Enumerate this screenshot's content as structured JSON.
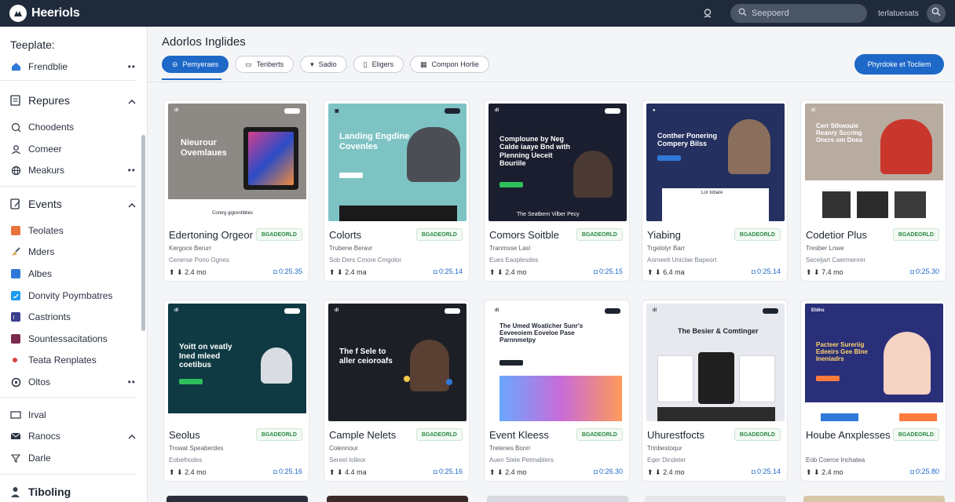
{
  "app": {
    "title": "Heeriols"
  },
  "topbar": {
    "search_placeholder": "Seepoerd",
    "user_text": "terlatuesats"
  },
  "sidebar": {
    "label": "Teeplate:",
    "top_item": "Frendblie",
    "sections": [
      {
        "title": "Repures",
        "items": [
          {
            "label": "Choodents",
            "icon": "bubble-icon"
          },
          {
            "label": "Comeer",
            "icon": "user-icon"
          },
          {
            "label": "Meakurs",
            "icon": "globe-icon",
            "dots": true
          }
        ]
      },
      {
        "title": "Events",
        "items": [
          {
            "label": "Teolates",
            "icon": "orange-square-icon",
            "color": "#e8743b"
          },
          {
            "label": "Mders",
            "icon": "brush-icon",
            "color": "#d9a441"
          },
          {
            "label": "Albes",
            "icon": "blue-square-icon",
            "color": "#2f7ad9"
          },
          {
            "label": "Donvity Poymbatres",
            "icon": "twitter-icon",
            "color": "#1d9bf0"
          },
          {
            "label": "Castrionts",
            "icon": "purple-square-icon",
            "color": "#3b3f8c"
          },
          {
            "label": "Sountessacitations",
            "icon": "maroon-square-icon",
            "color": "#7a2a4a"
          },
          {
            "label": "Teata Renplates",
            "icon": "red-dot-icon",
            "color": "#d94141"
          },
          {
            "label": "Oltos",
            "icon": "circle-icon",
            "dots": true
          }
        ]
      }
    ],
    "lower_items": [
      {
        "label": "Irval",
        "icon": "rect-icon"
      },
      {
        "label": "Ranocs",
        "icon": "mail-icon",
        "chevron": true
      },
      {
        "label": "Darle",
        "icon": "filter-icon"
      }
    ],
    "bottom_label": "Tiboling"
  },
  "main": {
    "title": "Adorlos Inglides",
    "tabs": [
      {
        "label": "Pemyeraes",
        "icon": "⊖",
        "active": true
      },
      {
        "label": "Tenberts",
        "icon": "▭"
      },
      {
        "label": "Sadio",
        "icon": "▾"
      },
      {
        "label": "Eligers",
        "icon": "▯"
      },
      {
        "label": "Compon Horlie",
        "icon": "▦"
      }
    ],
    "cta_label": "Phyrdoke et Tocliem"
  },
  "cards": [
    {
      "title": "Edertoning Orgeor",
      "badge": "BGADEORLD",
      "meta1": "Kergoce Berurr",
      "meta2": "Cenerse Pono Ognes",
      "stats": "⬆ ⬇ 2.4 mo",
      "price": "0:25.35",
      "thumb": {
        "headline": "Nieurour Ovemlaues",
        "caption": "Corerg gigrentiblies",
        "bg": "#8d8a86",
        "fg": "#ffffff"
      }
    },
    {
      "title": "Colorts",
      "badge": "BGADEORLD",
      "meta1": "Trubene Beravr",
      "meta2": "Sob Ders Cmore Cmgolor",
      "stats": "⬆ ⬇ 2.4 ma",
      "price": "0:25.14",
      "thumb": {
        "headline": "Landing Engdine Covenles",
        "caption": "",
        "bg": "#7ec3c4",
        "fg": "#ffffff"
      }
    },
    {
      "title": "Comors Soitble",
      "badge": "BGADEORLD",
      "meta1": "Tranmsse Lasl",
      "meta2": "Eues Eaoplesdes",
      "stats": "⬆ ⬇ 2.4 mo",
      "price": "0:25.15",
      "thumb": {
        "headline": "Comploune by Neg Calde iaaye Bnd with Plenning Ueceit Bouriile",
        "caption": "The Seatbern Vilber Pecy",
        "bg": "#1a1e2e",
        "fg": "#ffffff"
      }
    },
    {
      "title": "Yiabing",
      "badge": "BGADEORLD",
      "meta1": "Trgelolyr Barr",
      "meta2": "Anmeelt Uniclae Bapeort",
      "stats": "⬆ ⬇ 6.4 ma",
      "price": "0:25.14",
      "thumb": {
        "headline": "Conther Ponering Compery Bilss",
        "caption": "Lor tobare",
        "bg": "#24305f",
        "fg": "#ffffff"
      }
    },
    {
      "title": "Codetior Plus",
      "badge": "BGADEORLD",
      "meta1": "Tresber Lnwe",
      "meta2": "Seceljart Caermenrer",
      "stats": "⬆ ⬇ 7.4 mo",
      "price": "0:25.30",
      "thumb": {
        "headline": "Cerr Sthwouie Reanry Sccring Oncrs om Doea",
        "caption": "",
        "bg": "#b8aba0",
        "fg": "#ffffff"
      }
    },
    {
      "title": "Seolus",
      "badge": "BGADEORLD",
      "meta1": "Trowat Speaberdes",
      "meta2": "Eobelhodes",
      "stats": "⬆ ⬇ 2.4 mo",
      "price": "0:25.16",
      "thumb": {
        "headline": "Yoitt on veatly Ined mleed coetibus",
        "caption": "",
        "bg": "#0f3a44",
        "fg": "#ffffff"
      }
    },
    {
      "title": "Cample Nelets",
      "badge": "BGADEORLD",
      "meta1": "Colennour",
      "meta2": "Sereel lolleor",
      "stats": "⬆ ⬇ 4.4 ma",
      "price": "0:25.16",
      "thumb": {
        "headline": "The f Sele to aller ceioroafs",
        "caption": "",
        "bg": "#1c1f26",
        "fg": "#ffffff"
      }
    },
    {
      "title": "Event Kleess",
      "badge": "BGADEORLD",
      "meta1": "Trelenes Bonrr",
      "meta2": "Auen Stele Petmablers",
      "stats": "⬆ ⬇ 2.4 mo",
      "price": "0:26.30",
      "thumb": {
        "headline": "The Umed Woaticher Sunr's Eeveeoiem Eoveloe Pase Parnnmetpy",
        "caption": "",
        "bg": "#ffffff",
        "fg": "#1d2430"
      }
    },
    {
      "title": "Uhurestfocts",
      "badge": "BGADEORLD",
      "meta1": "Trinbestoqur",
      "meta2": "Eqer Dindeter",
      "stats": "⬆ ⬇ 2.4 mo",
      "price": "0:25.14",
      "thumb": {
        "headline": "The Besier & Comtinger",
        "caption": "",
        "bg": "#e7e9ee",
        "fg": "#1d2430"
      }
    },
    {
      "title": "Hoube Anxplesses",
      "badge": "BGADEORLD",
      "meta1": "Eob Coerce Inchatea",
      "meta2": "",
      "stats": "⬆ ⬇ 2.4 mo",
      "price": "0:25.80",
      "thumb": {
        "headline": "Pacteer Sureriig Edeeirs Gee Blne Ineniadrs",
        "caption": "",
        "bg": "#2a2f7a",
        "fg": "#ffd36b"
      }
    }
  ]
}
